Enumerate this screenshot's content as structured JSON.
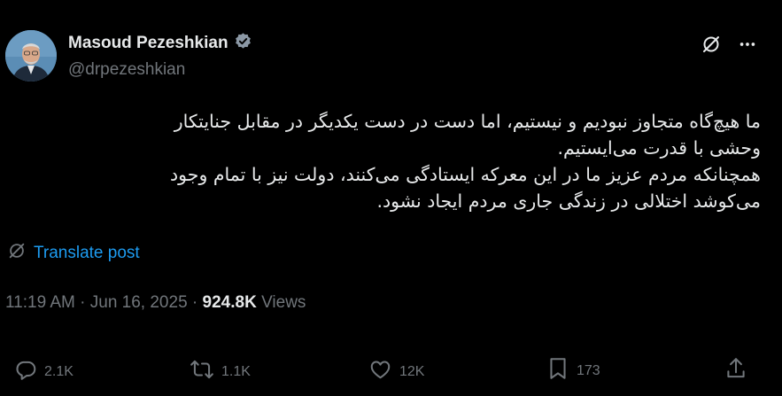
{
  "author": {
    "name": "Masoud Pezeshkian",
    "handle": "@drpezeshkian",
    "verified": true,
    "verified_color": "#8b98a5"
  },
  "top_icons": [
    "grok-icon",
    "more-options-icon"
  ],
  "post": {
    "lines": [
      "ما هیچ‌گاه متجاوز نبودیم و نیستیم، اما دست در دست یکدیگر در مقابل جنایتکار",
      "وحشی با قدرت می‌ایستیم.",
      "همچنانکه مردم عزیز ما در این معرکه ایستادگی می‌کنند، دولت نیز با تمام وجود",
      "می‌کوشد اختلالی در زندگی جاری مردم ایجاد نشود."
    ]
  },
  "translate": {
    "label": "Translate post",
    "color": "#1d9bf0"
  },
  "meta": {
    "time": "11:19 AM",
    "separator": "·",
    "date": "Jun 16, 2025",
    "views_count": "924.8K",
    "views_label": "Views"
  },
  "actions": {
    "replies": "2.1K",
    "reposts": "1.1K",
    "likes": "12K",
    "bookmarks": "173"
  },
  "colors": {
    "background": "#000000",
    "text": "#e7e9ea",
    "secondary": "#71767b"
  }
}
